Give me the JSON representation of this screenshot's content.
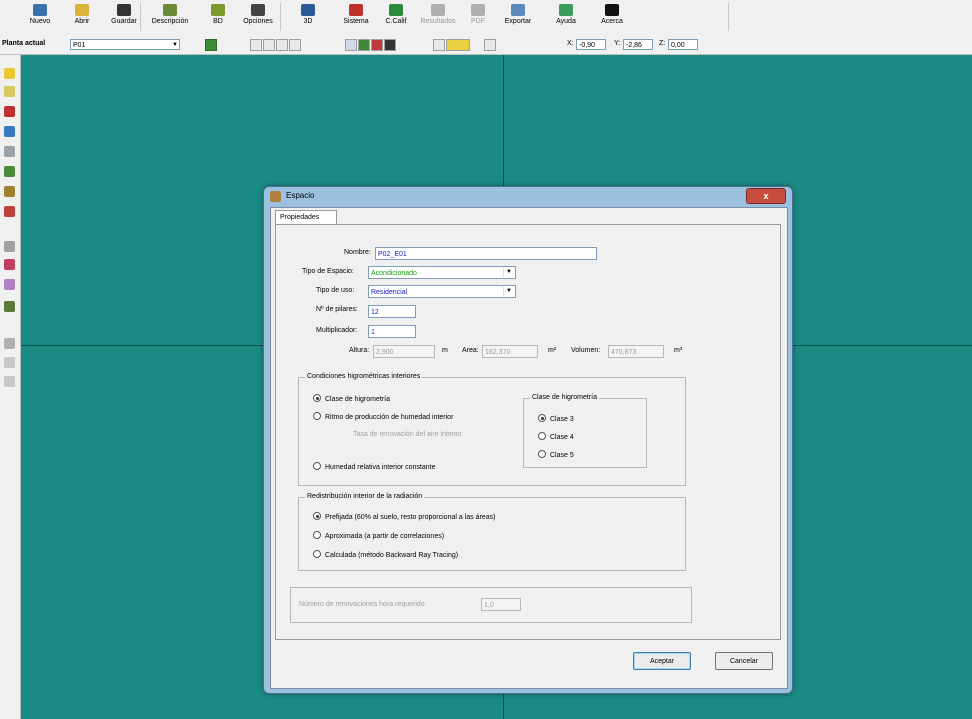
{
  "toolbar": {
    "buttons": [
      {
        "label": "Nuevo",
        "icon": "new-file-icon",
        "color": "#3a6fb0"
      },
      {
        "label": "Abrir",
        "icon": "open-folder-icon",
        "color": "#d9b33a"
      },
      {
        "label": "Guardar",
        "icon": "save-disk-icon",
        "color": "#333333"
      },
      {
        "label": "Descripción",
        "icon": "description-icon",
        "color": "#6a8a3a"
      },
      {
        "label": "BD",
        "icon": "database-icon",
        "color": "#7a9a2a"
      },
      {
        "label": "Opciones",
        "icon": "options-arrow-icon",
        "color": "#444444"
      },
      {
        "label": "3D",
        "icon": "3d-view-icon",
        "color": "#2a5a9a"
      },
      {
        "label": "Sistema",
        "icon": "system-icon",
        "color": "#c0302a"
      },
      {
        "label": "C.Calif",
        "icon": "calification-icon",
        "color": "#2a8a3a"
      },
      {
        "label": "Resultados",
        "icon": "results-icon",
        "color": "#b0b0b0"
      },
      {
        "label": "PDF",
        "icon": "pdf-icon",
        "color": "#b0b0b0"
      },
      {
        "label": "Exportar",
        "icon": "export-icon",
        "color": "#5a8aba"
      },
      {
        "label": "Ayuda",
        "icon": "help-globe-icon",
        "color": "#3a9a5a"
      },
      {
        "label": "Acerca",
        "icon": "about-question-icon",
        "color": "#111111"
      }
    ]
  },
  "toolbar2": {
    "planta_label": "Planta actual",
    "planta_value": "P01",
    "x_label": "X:",
    "x_value": "-0,90",
    "y_label": "Y:",
    "y_value": "-2,86",
    "z_label": "Z:",
    "z_value": "0,00"
  },
  "dialog": {
    "title": "Espacio",
    "close": "x",
    "tab": "Propiedades",
    "nombre_label": "Nombre:",
    "nombre_value": "P02_E01",
    "tipo_espacio_label": "Tipo de Espacio:",
    "tipo_espacio_value": "Acondicionado",
    "tipo_uso_label": "Tipo de uso:",
    "tipo_uso_value": "Residencial",
    "pilares_label": "Nº de pilares:",
    "pilares_value": "12",
    "multiplicador_label": "Multiplicador:",
    "multiplicador_value": "1",
    "altura_label": "Altura:",
    "altura_value": "2,900",
    "altura_unit": "m",
    "area_label": "Area:",
    "area_value": "162,370",
    "area_unit": "m²",
    "volumen_label": "Volumen:",
    "volumen_value": "470,873",
    "volumen_unit": "m³",
    "higro_group": "Condiciones higrométricas interiores",
    "higro_opt1": "Clase de higrometría",
    "higro_opt2": "Ritmo de producción de humedad interior",
    "higro_dim": "Tasa de renovación del aire interior",
    "higro_opt3": "Humedad relativa interior constante",
    "clase_group": "Clase de higrometría",
    "clase3": "Clase 3",
    "clase4": "Clase 4",
    "clase5": "Clase 5",
    "rad_group": "Redistribución interior de la radiación",
    "rad_opt1": "Prefijada (60% al suelo, resto proporcional a las áreas)",
    "rad_opt2": "Aproximada (a partir de correlaciones)",
    "rad_opt3": "Calculada (método Backward Ray Tracing)",
    "renov_label": "Número de renovaciones hora requerido",
    "renov_value": "1,0",
    "accept": "Aceptar",
    "cancel": "Cancelar"
  }
}
